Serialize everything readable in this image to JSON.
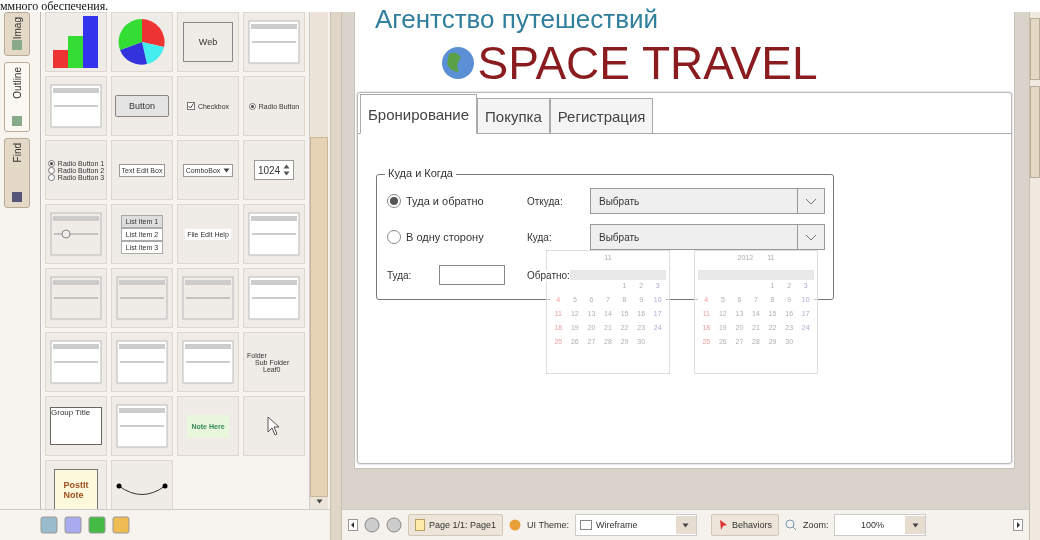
{
  "doc_fragment": "ммного обеспечения.",
  "side_tabs": [
    {
      "label": "Imag",
      "selected": false
    },
    {
      "label": "Outline",
      "selected": true
    },
    {
      "label": "Find",
      "selected": false
    }
  ],
  "palette": {
    "items": [
      {
        "kind": "bar-chart"
      },
      {
        "kind": "pie-chart"
      },
      {
        "kind": "web",
        "labels": [
          "Web"
        ]
      },
      {
        "kind": "list-window"
      },
      {
        "kind": "calendar"
      },
      {
        "kind": "button",
        "labels": [
          "Button"
        ]
      },
      {
        "kind": "checkbox",
        "labels": [
          "Checkbox"
        ]
      },
      {
        "kind": "radio",
        "labels": [
          "Radio Button"
        ]
      },
      {
        "kind": "radio-group",
        "labels": [
          "Radio Button 1",
          "Radio Button 2",
          "Radio Button 3"
        ]
      },
      {
        "kind": "textbox",
        "labels": [
          "Text Edit Box"
        ]
      },
      {
        "kind": "combobox",
        "labels": [
          "ComboBox"
        ]
      },
      {
        "kind": "spinner",
        "labels": [
          "1024"
        ]
      },
      {
        "kind": "slider"
      },
      {
        "kind": "list",
        "labels": [
          "List Item 1",
          "List Item 2",
          "List Item 3"
        ]
      },
      {
        "kind": "menubar",
        "labels": [
          "File",
          "Edit",
          "Help"
        ]
      },
      {
        "kind": "menu"
      },
      {
        "kind": "hslider"
      },
      {
        "kind": "progress"
      },
      {
        "kind": "hscroll"
      },
      {
        "kind": "scrollpane"
      },
      {
        "kind": "tabs"
      },
      {
        "kind": "vtabs"
      },
      {
        "kind": "table"
      },
      {
        "kind": "tree",
        "labels": [
          "Folder",
          "Sub Folder",
          "Leaf0"
        ]
      },
      {
        "kind": "group",
        "labels": [
          "Group Title"
        ]
      },
      {
        "kind": "window"
      },
      {
        "kind": "note",
        "labels": [
          "Note Here"
        ]
      },
      {
        "kind": "cursor"
      },
      {
        "kind": "postit",
        "labels": [
          "PostIt",
          "Note"
        ]
      },
      {
        "kind": "curve"
      }
    ]
  },
  "page": {
    "subtitle": "Агентство путешествий",
    "title": "SPACE TRAVEL",
    "tabs": [
      {
        "label": "Бронирование",
        "selected": true
      },
      {
        "label": "Покупка",
        "selected": false
      },
      {
        "label": "Регистрация",
        "selected": false
      }
    ],
    "group": {
      "title": "Куда и Когда",
      "trip_options": [
        {
          "label": "Туда и обратно",
          "selected": true
        },
        {
          "label": "В одну сторону",
          "selected": false
        }
      ],
      "from": {
        "label": "Откуда:",
        "value": "Выбрать"
      },
      "to": {
        "label": "Куда:",
        "value": "Выбрать"
      },
      "depart": {
        "label": "Туда:"
      },
      "return": {
        "label": "Обратно:"
      }
    },
    "calendars": [
      {
        "header": [
          "11"
        ],
        "weeks": [
          [
            "1",
            "2",
            "3"
          ],
          [
            "4",
            "5",
            "6",
            "7",
            "8",
            "9",
            "10"
          ],
          [
            "11",
            "12",
            "13",
            "14",
            "15",
            "16",
            "17"
          ],
          [
            "18",
            "19",
            "20",
            "21",
            "22",
            "23",
            "24"
          ],
          [
            "25",
            "26",
            "27",
            "28",
            "29",
            "30"
          ]
        ]
      },
      {
        "header": [
          "2012",
          "11"
        ],
        "weeks": [
          [
            "1",
            "2",
            "3"
          ],
          [
            "4",
            "5",
            "6",
            "7",
            "8",
            "9",
            "10"
          ],
          [
            "11",
            "12",
            "13",
            "14",
            "15",
            "16",
            "17"
          ],
          [
            "18",
            "19",
            "20",
            "21",
            "22",
            "23",
            "24"
          ],
          [
            "25",
            "26",
            "27",
            "28",
            "29",
            "30"
          ]
        ]
      }
    ]
  },
  "toolbar": {
    "page": "Page 1/1: Page1",
    "theme_label": "UI Theme:",
    "theme": "Wireframe",
    "behaviors": "Behaviors",
    "zoom_label": "Zoom:",
    "zoom": "100%"
  }
}
